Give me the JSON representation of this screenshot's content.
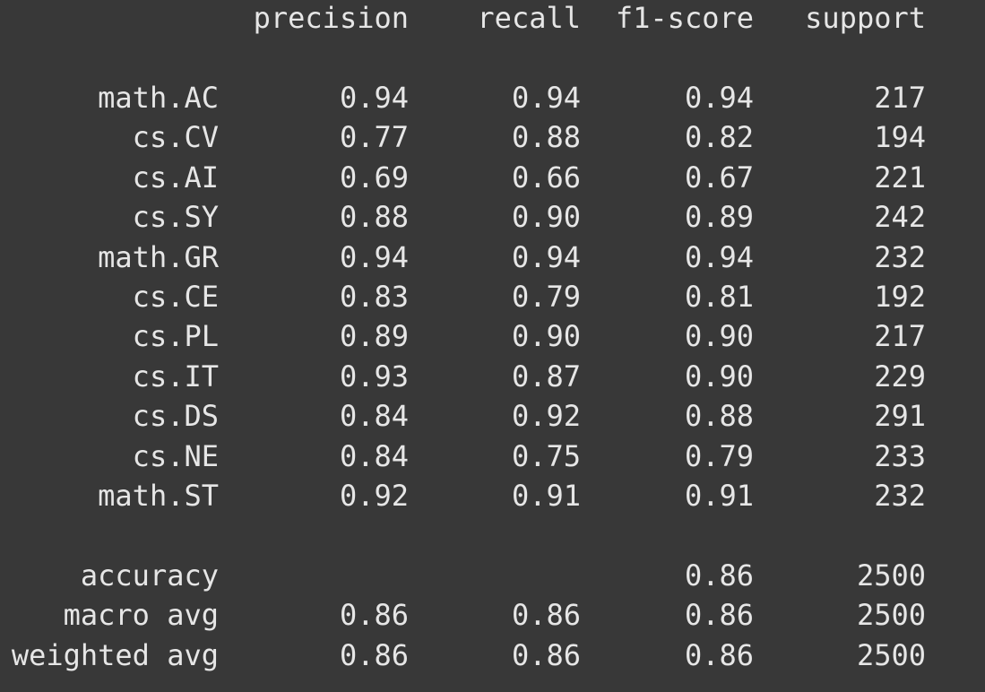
{
  "header": {
    "precision": "precision",
    "recall": "recall",
    "f1": "f1-score",
    "support": "support"
  },
  "rows": [
    {
      "label": "math.AC",
      "precision": "0.94",
      "recall": "0.94",
      "f1": "0.94",
      "support": "217"
    },
    {
      "label": "cs.CV",
      "precision": "0.77",
      "recall": "0.88",
      "f1": "0.82",
      "support": "194"
    },
    {
      "label": "cs.AI",
      "precision": "0.69",
      "recall": "0.66",
      "f1": "0.67",
      "support": "221"
    },
    {
      "label": "cs.SY",
      "precision": "0.88",
      "recall": "0.90",
      "f1": "0.89",
      "support": "242"
    },
    {
      "label": "math.GR",
      "precision": "0.94",
      "recall": "0.94",
      "f1": "0.94",
      "support": "232"
    },
    {
      "label": "cs.CE",
      "precision": "0.83",
      "recall": "0.79",
      "f1": "0.81",
      "support": "192"
    },
    {
      "label": "cs.PL",
      "precision": "0.89",
      "recall": "0.90",
      "f1": "0.90",
      "support": "217"
    },
    {
      "label": "cs.IT",
      "precision": "0.93",
      "recall": "0.87",
      "f1": "0.90",
      "support": "229"
    },
    {
      "label": "cs.DS",
      "precision": "0.84",
      "recall": "0.92",
      "f1": "0.88",
      "support": "291"
    },
    {
      "label": "cs.NE",
      "precision": "0.84",
      "recall": "0.75",
      "f1": "0.79",
      "support": "233"
    },
    {
      "label": "math.ST",
      "precision": "0.92",
      "recall": "0.91",
      "f1": "0.91",
      "support": "232"
    }
  ],
  "summary": {
    "accuracy": {
      "label": "accuracy",
      "f1": "0.86",
      "support": "2500"
    },
    "macro": {
      "label": "macro avg",
      "precision": "0.86",
      "recall": "0.86",
      "f1": "0.86",
      "support": "2500"
    },
    "weighted": {
      "label": "weighted avg",
      "precision": "0.86",
      "recall": "0.86",
      "f1": "0.86",
      "support": "2500"
    }
  }
}
